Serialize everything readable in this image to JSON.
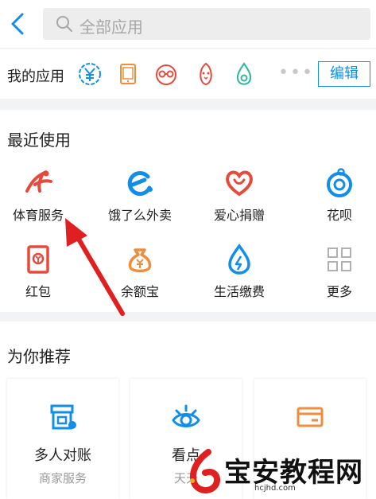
{
  "search": {
    "placeholder": "全部应用"
  },
  "my_apps": {
    "label": "我的应用",
    "more": "•••",
    "edit_label": "编辑"
  },
  "recent": {
    "title": "最近使用",
    "items": [
      {
        "label": "体育服务",
        "icon": "sports-icon"
      },
      {
        "label": "饿了么外卖",
        "icon": "eleme-icon"
      },
      {
        "label": "爱心捐赠",
        "icon": "heart-donation-icon"
      },
      {
        "label": "花呗",
        "icon": "huabei-icon"
      },
      {
        "label": "红包",
        "icon": "red-envelope-icon"
      },
      {
        "label": "余额宝",
        "icon": "yuebao-icon"
      },
      {
        "label": "生活缴费",
        "icon": "utility-payment-icon"
      },
      {
        "label": "更多",
        "icon": "more-grid-icon"
      }
    ]
  },
  "recommend": {
    "title": "为你推荐",
    "cards": [
      {
        "title": "多人对账",
        "subtitle": "商家服务"
      },
      {
        "title": "看点",
        "subtitle": "天天"
      },
      {
        "title": "",
        "subtitle": ""
      }
    ]
  },
  "watermark": {
    "text": "宝安教程网",
    "url": "hcjhd.com"
  },
  "colors": {
    "accent": "#108ee9",
    "red": "#e54b3c",
    "orange": "#f08d3c",
    "arrow": "#e02020"
  }
}
